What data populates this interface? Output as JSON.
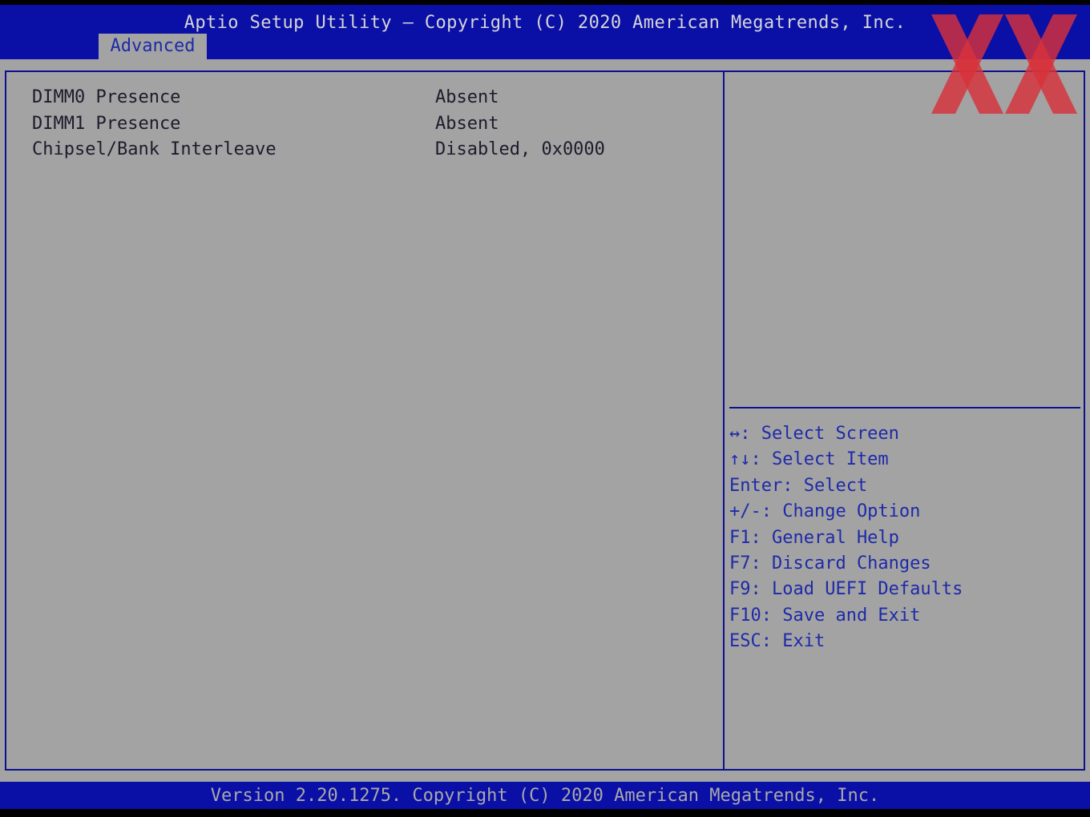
{
  "header": {
    "title": "Aptio Setup Utility – Copyright (C) 2020 American Megatrends, Inc.",
    "tabs": [
      {
        "label": "Advanced",
        "active": true
      }
    ]
  },
  "main": {
    "items": [
      {
        "label": "DIMM0 Presence",
        "value": "Absent"
      },
      {
        "label": "DIMM1 Presence",
        "value": "Absent"
      },
      {
        "label": "Chipsel/Bank Interleave",
        "value": "Disabled, 0x0000"
      }
    ]
  },
  "help": {
    "lines": [
      "↔: Select Screen",
      "↑↓: Select Item",
      "Enter: Select",
      "+/-: Change Option",
      "F1: General Help",
      "F7: Discard Changes",
      "F9: Load UEFI Defaults",
      "F10: Save and Exit",
      "ESC: Exit"
    ]
  },
  "footer": {
    "text": "Version 2.20.1275. Copyright (C) 2020 American Megatrends, Inc."
  },
  "colors": {
    "header_bg": "#0a0fa6",
    "panel_bg": "#a3a3a3",
    "help_text": "#1e2aa8",
    "logo_red": "#d8323a"
  },
  "icons": {
    "logo": "xx-watermark-logo"
  }
}
